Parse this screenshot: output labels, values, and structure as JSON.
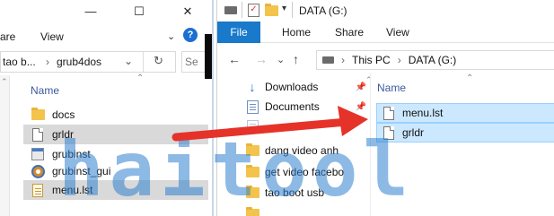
{
  "left_window": {
    "title": "grub4dos",
    "controls": {
      "minimize": "—",
      "maximize": "☐",
      "close": "✕"
    },
    "ribbon": {
      "share": "are",
      "view": "View",
      "help": "?"
    },
    "address": {
      "crumb1": "tao b...",
      "sep": "›",
      "crumb2": "grub4dos"
    },
    "search_placeholder": "Se",
    "column_name": "Name",
    "files": [
      {
        "name": "docs",
        "icon": "folder-icon",
        "selected": false
      },
      {
        "name": "grldr",
        "icon": "file-icon",
        "selected": true
      },
      {
        "name": "grubinst",
        "icon": "app-icon",
        "selected": false
      },
      {
        "name": "grubinst_gui",
        "icon": "gear-app-icon",
        "selected": false
      },
      {
        "name": "menu.lst",
        "icon": "text-file-icon",
        "selected": true
      }
    ]
  },
  "right_window": {
    "title": "DATA (G:)",
    "ribbon": {
      "file": "File",
      "home": "Home",
      "share": "Share",
      "view": "View"
    },
    "address": {
      "this_pc": "This PC",
      "sep": "›",
      "drive": "DATA (G:)"
    },
    "tree": [
      {
        "name": "Downloads",
        "icon": "download-icon",
        "pinned": true
      },
      {
        "name": "Documents",
        "icon": "documents-icon",
        "pinned": true
      },
      {
        "name": "dang video anh",
        "icon": "folder-icon",
        "pinned": false
      },
      {
        "name": "get video facebo",
        "icon": "folder-icon",
        "pinned": false
      },
      {
        "name": "tao boot usb",
        "icon": "folder-icon",
        "pinned": false
      }
    ],
    "column_name": "Name",
    "files": [
      {
        "name": "menu.lst",
        "icon": "file-icon",
        "selected": true
      },
      {
        "name": "grldr",
        "icon": "file-icon",
        "selected": true
      }
    ]
  },
  "watermark": {
    "text": "haitool"
  },
  "colors": {
    "accent": "#1979ca",
    "selection": "#cce8ff",
    "arrow": "#e5332a",
    "watermark": "#2f7fd0"
  }
}
